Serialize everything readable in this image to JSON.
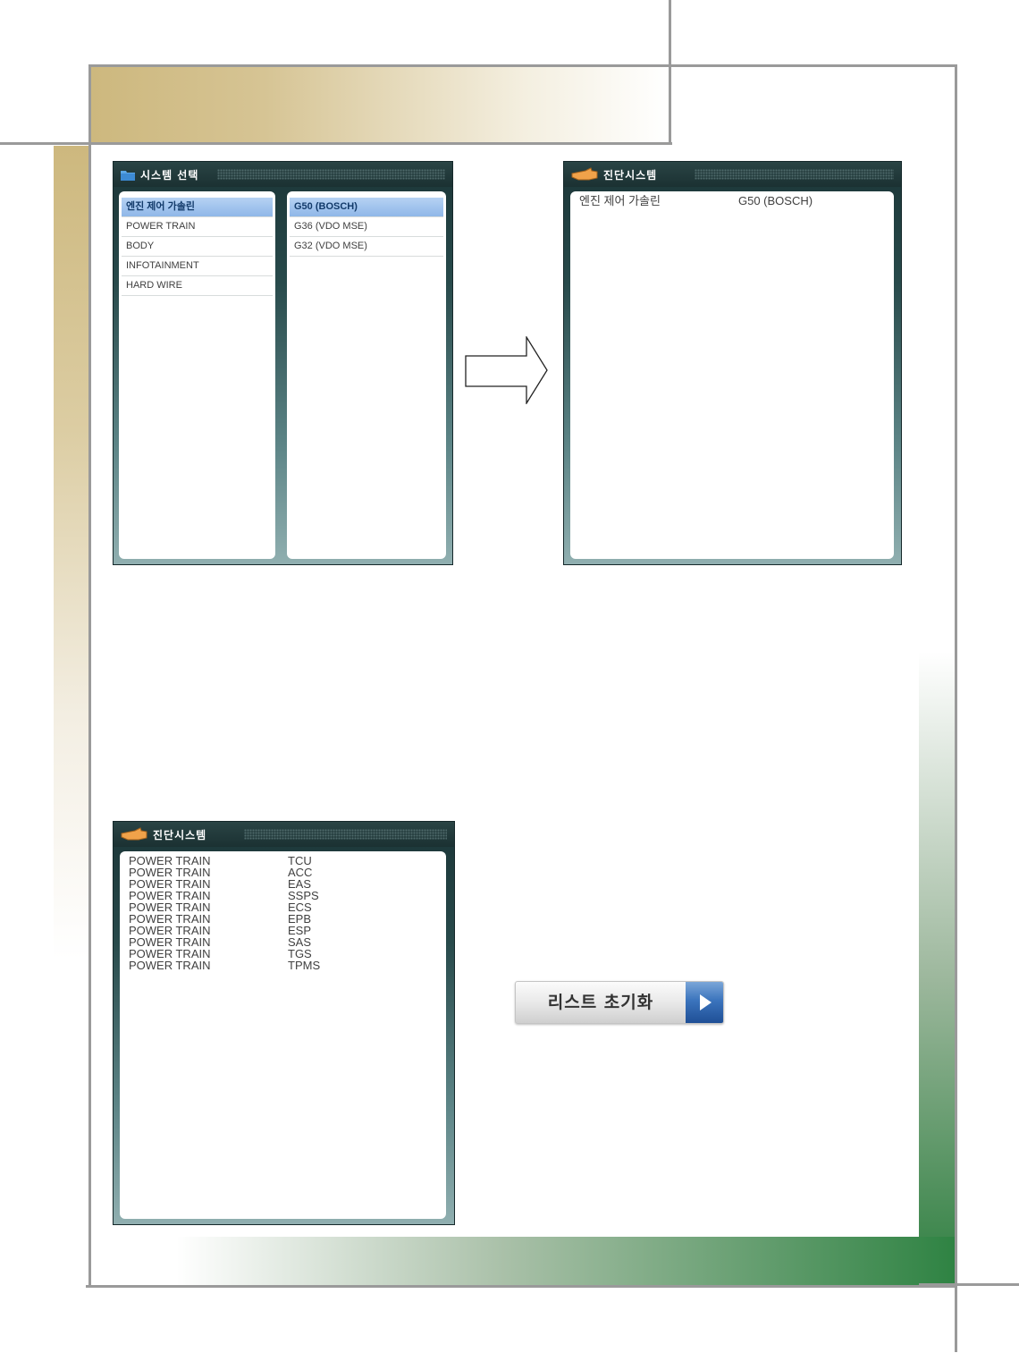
{
  "system_select_panel": {
    "title": "시스템 선택",
    "left_list": [
      {
        "label": "엔진 제어 가솔린",
        "selected": true
      },
      {
        "label": "POWER TRAIN",
        "selected": false
      },
      {
        "label": "BODY",
        "selected": false
      },
      {
        "label": "INFOTAINMENT",
        "selected": false
      },
      {
        "label": "HARD WIRE",
        "selected": false
      }
    ],
    "right_list": [
      {
        "label": "G50 (BOSCH)",
        "selected": true
      },
      {
        "label": "G36 (VDO MSE)",
        "selected": false
      },
      {
        "label": "G32 (VDO MSE)",
        "selected": false
      }
    ]
  },
  "diagnosis_panel_top": {
    "title": "진단시스템",
    "rows": [
      {
        "system": "엔진 제어 가솔린",
        "module": "G50 (BOSCH)"
      }
    ]
  },
  "diagnosis_panel_bottom": {
    "title": "진단시스템",
    "rows": [
      {
        "system": "POWER TRAIN",
        "module": "TCU"
      },
      {
        "system": "POWER TRAIN",
        "module": "ACC"
      },
      {
        "system": "POWER TRAIN",
        "module": "EAS"
      },
      {
        "system": "POWER TRAIN",
        "module": "SSPS"
      },
      {
        "system": "POWER TRAIN",
        "module": "ECS"
      },
      {
        "system": "POWER TRAIN",
        "module": "EPB"
      },
      {
        "system": "POWER TRAIN",
        "module": "ESP"
      },
      {
        "system": "POWER TRAIN",
        "module": "SAS"
      },
      {
        "system": "POWER TRAIN",
        "module": "TGS"
      },
      {
        "system": "POWER TRAIN",
        "module": "TPMS"
      }
    ]
  },
  "reset_button": {
    "label": "리스트 초기화"
  },
  "icons": {
    "folder": "folder-icon",
    "hand": "pointing-hand-icon",
    "arrow": "right-arrow-icon",
    "play": "play-arrow-icon"
  },
  "colors": {
    "selection": "#8fb7e8",
    "panel_dark": "#1b3537",
    "frame_gold": "#cdb87e",
    "frame_green": "#2e7f40"
  }
}
